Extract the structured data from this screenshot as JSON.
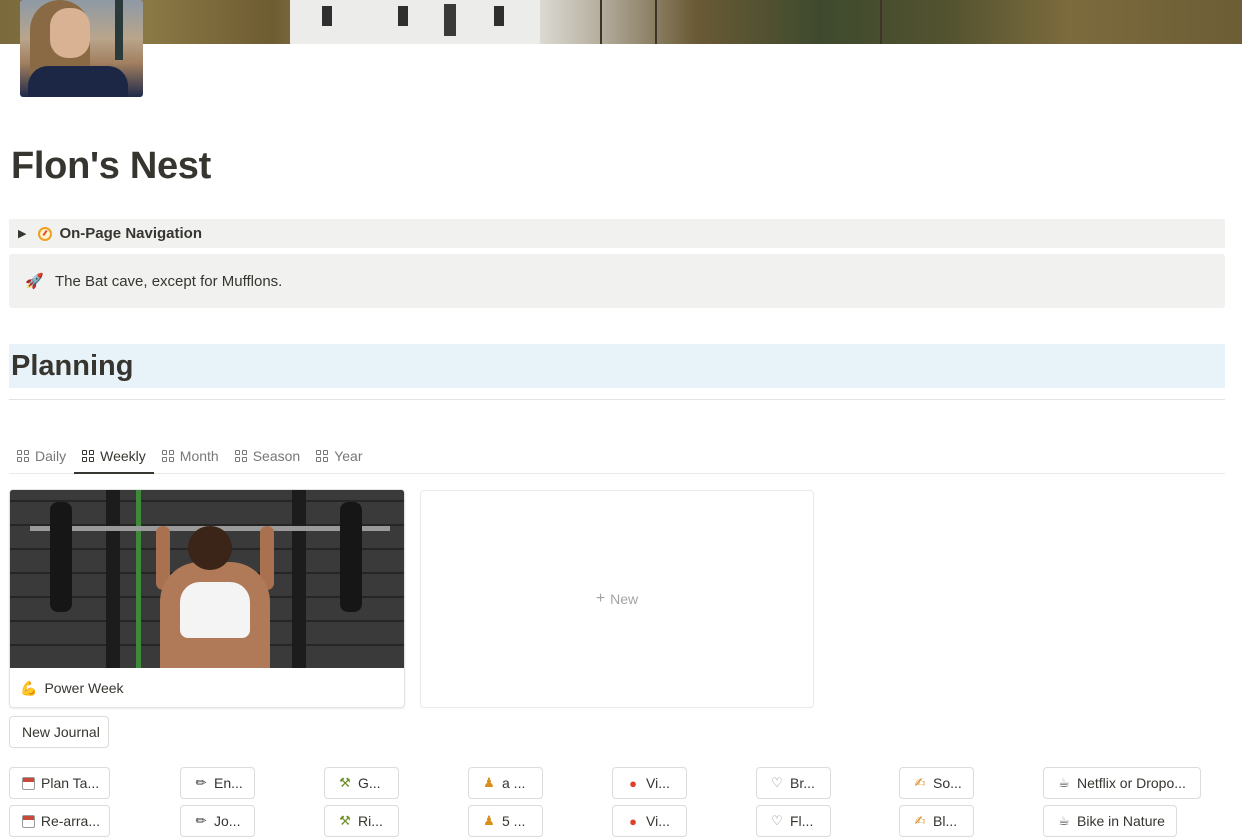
{
  "page": {
    "title": "Flon's Nest"
  },
  "navigation_toggle": {
    "label": "On-Page Navigation",
    "icon": "compass-icon"
  },
  "callout": {
    "icon": "rocket-icon",
    "text": "The Bat cave, except for Mufflons."
  },
  "planning": {
    "heading": "Planning",
    "tabs": [
      {
        "label": "Daily",
        "active": false
      },
      {
        "label": "Weekly",
        "active": true
      },
      {
        "label": "Month",
        "active": false
      },
      {
        "label": "Season",
        "active": false
      },
      {
        "label": "Year",
        "active": false
      }
    ],
    "cards": [
      {
        "title": "Power Week",
        "icon": "muscle-icon"
      }
    ],
    "new_card_label": "New"
  },
  "buttons": {
    "new_journal": "New Journal",
    "row1": [
      {
        "label": "Plan Ta...",
        "icon": "calendar-icon"
      },
      {
        "label": "En...",
        "icon": "pencil-icon"
      },
      {
        "label": "G...",
        "icon": "tool-icon"
      },
      {
        "label": "a ...",
        "icon": "person-icon"
      },
      {
        "label": "Vi...",
        "icon": "pill-icon"
      },
      {
        "label": "Br...",
        "icon": "tooth-icon"
      },
      {
        "label": "So...",
        "icon": "note-icon"
      },
      {
        "label": "Netflix or Dropo...",
        "icon": "couch-icon"
      }
    ],
    "row2": [
      {
        "label": "Re-arra...",
        "icon": "calendar-icon"
      },
      {
        "label": "Jo...",
        "icon": "pencil-icon"
      },
      {
        "label": "Ri...",
        "icon": "tool-icon"
      },
      {
        "label": "5 ...",
        "icon": "person-icon"
      },
      {
        "label": "Vi...",
        "icon": "pill-icon"
      },
      {
        "label": "Fl...",
        "icon": "tooth-icon"
      },
      {
        "label": "Bl...",
        "icon": "note-icon"
      },
      {
        "label": "Bike in Nature",
        "icon": "couch-icon"
      }
    ]
  },
  "colors": {
    "text": "#37352f",
    "muted": "#787774",
    "heading_bg": "#e7f3f8",
    "callout_bg": "#f1f1ef"
  }
}
